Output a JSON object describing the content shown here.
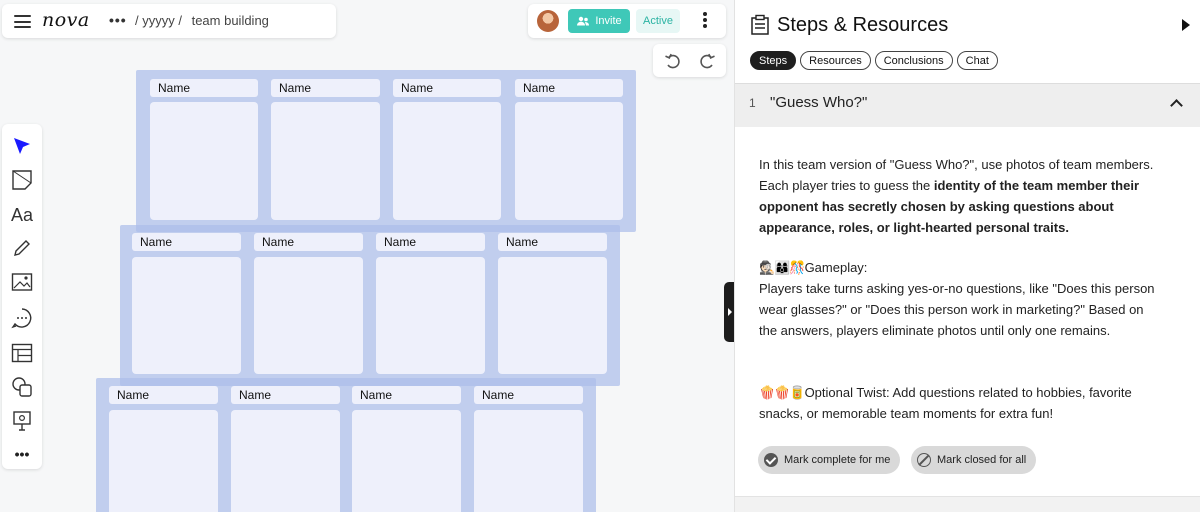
{
  "app": {
    "logo": "nova"
  },
  "breadcrumb": {
    "parent": "/ yyyyy /",
    "current": "team building"
  },
  "presence": {
    "invite_label": "Invite",
    "status_label": "Active"
  },
  "boards": [
    {
      "names": [
        "Name",
        "Name",
        "Name",
        "Name"
      ]
    },
    {
      "names": [
        "Name",
        "Name",
        "Name",
        "Name"
      ]
    },
    {
      "names": [
        "Name",
        "Name",
        "Name",
        "Name"
      ]
    }
  ],
  "panel": {
    "title": "Steps & Resources",
    "tabs": [
      "Steps",
      "Resources",
      "Conclusions",
      "Chat"
    ],
    "selected_tab": "Steps",
    "step": {
      "number": "1",
      "title": "\"Guess Who?\"",
      "intro_plain": "In this team version of \"Guess Who?\", use photos of team members. Each player tries to guess the ",
      "intro_bold": "identity of the team member their opponent has secretly chosen by asking questions about appearance, roles, or light-hearted personal traits.",
      "gameplay_emoji": "🕵🏻👩‍👩‍👦🎊",
      "gameplay_heading": "Gameplay:",
      "gameplay_text": "Players take turns asking yes-or-no questions, like \"Does this person wear glasses?\" or \"Does this person work in marketing?\" Based on the answers, players eliminate photos until only one remains.",
      "twist_emoji": "🍿🍿🥫",
      "twist_heading": "Optional Twist:",
      "twist_text": " Add questions related to hobbies, favorite snacks, or memorable team moments for extra fun!"
    },
    "buttons": {
      "complete": "Mark complete for me",
      "closed": "Mark closed for all"
    }
  },
  "colors": {
    "accent": "#3fc8b8",
    "board": "#acbeea",
    "card": "#eef0fb",
    "select_arrow": "#1a1aff"
  }
}
